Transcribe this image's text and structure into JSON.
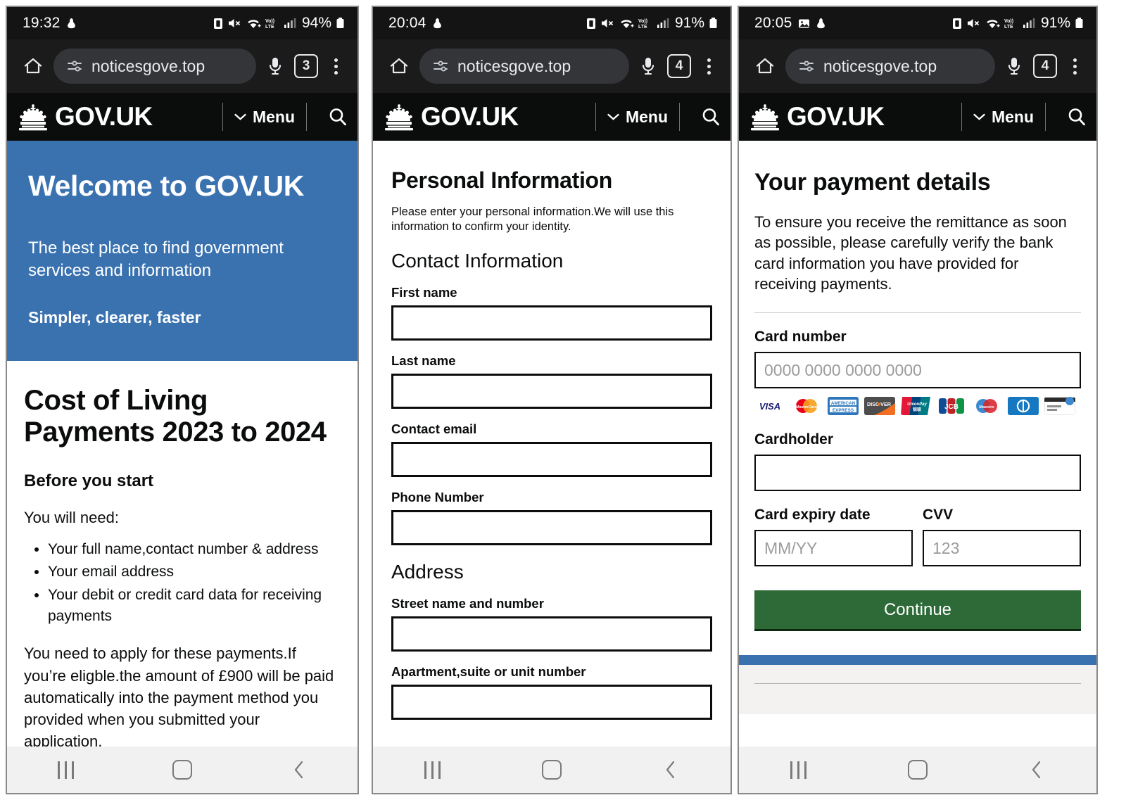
{
  "panels": [
    {
      "status": {
        "time": "19:32",
        "battery_pct": "94%",
        "network": "LTE",
        "icons": [
          "clipboard-icon",
          "mute-icon",
          "wifi-icon",
          "volte-icon",
          "signal-icon",
          "battery-icon"
        ]
      },
      "browser": {
        "url": "noticesgove.top",
        "tab_count": "3",
        "home_icon": "home-icon",
        "mic_icon": "microphone-icon",
        "menu_icon": "kebab-menu-icon",
        "permissions_icon": "page-info-icon"
      },
      "govuk_header": {
        "brand": "GOV.UK",
        "menu_label": "Menu",
        "search_icon": "search-icon",
        "crown_icon": "crown-icon"
      },
      "hero": {
        "title": "Welcome to GOV.UK",
        "subtitle": "The best place to find government services and information",
        "tagline": "Simpler, clearer, faster",
        "bg_color": "#3a72b0"
      },
      "article": {
        "title": "Cost of Living Payments 2023 to 2024",
        "subheading": "Before you start",
        "lead": "You will need:",
        "bullets": [
          "Your full name,contact number & address",
          "Your email address",
          "Your debit or credit card data for receiving payments"
        ],
        "body": "You need to apply for these payments.If you’re eligble.the amount of £900 will be paid automatically into the payment method you provided when you submitted your application."
      }
    },
    {
      "status": {
        "time": "20:04",
        "battery_pct": "91%",
        "network": "LTE"
      },
      "browser": {
        "url": "noticesgove.top",
        "tab_count": "4"
      },
      "govuk_header": {
        "brand": "GOV.UK",
        "menu_label": "Menu"
      },
      "form": {
        "title": "Personal Information",
        "intro": "Please enter your personal information.We will use this information to confirm your identity.",
        "sections": [
          {
            "heading": "Contact Information",
            "fields": [
              {
                "label": "First name",
                "value": "",
                "placeholder": ""
              },
              {
                "label": "Last name",
                "value": "",
                "placeholder": ""
              },
              {
                "label": "Contact email",
                "value": "",
                "placeholder": ""
              },
              {
                "label": "Phone Number",
                "value": "",
                "placeholder": ""
              }
            ]
          },
          {
            "heading": "Address",
            "fields": [
              {
                "label": "Street name and number",
                "value": "",
                "placeholder": ""
              },
              {
                "label": "Apartment,suite or unit number",
                "value": "",
                "placeholder": ""
              }
            ]
          }
        ]
      }
    },
    {
      "status": {
        "time": "20:05",
        "battery_pct": "91%",
        "network": "LTE"
      },
      "browser": {
        "url": "noticesgove.top",
        "tab_count": "4"
      },
      "govuk_header": {
        "brand": "GOV.UK",
        "menu_label": "Menu"
      },
      "payment": {
        "title": "Your payment details",
        "intro": "To ensure you receive the remittance as soon as possible, please carefully verify the bank card information you have provided for receiving payments.",
        "card_number": {
          "label": "Card number",
          "value": "",
          "placeholder": "0000 0000 0000 0000"
        },
        "card_brands": [
          "VISA",
          "Mastercard",
          "American Express",
          "Discover",
          "UnionPay",
          "JCB",
          "Maestro",
          "Diners Club",
          "Generic Card"
        ],
        "cardholder": {
          "label": "Cardholder",
          "value": "",
          "placeholder": ""
        },
        "expiry": {
          "label": "Card expiry date",
          "value": "",
          "placeholder": "MM/YY"
        },
        "cvv": {
          "label": "CVV",
          "value": "",
          "placeholder": "123"
        },
        "continue_label": "Continue",
        "continue_color": "#2d6a37"
      }
    }
  ],
  "navbar": {
    "recents_icon": "recents-icon",
    "home_icon": "home-square-icon",
    "back_icon": "back-chevron-icon"
  }
}
